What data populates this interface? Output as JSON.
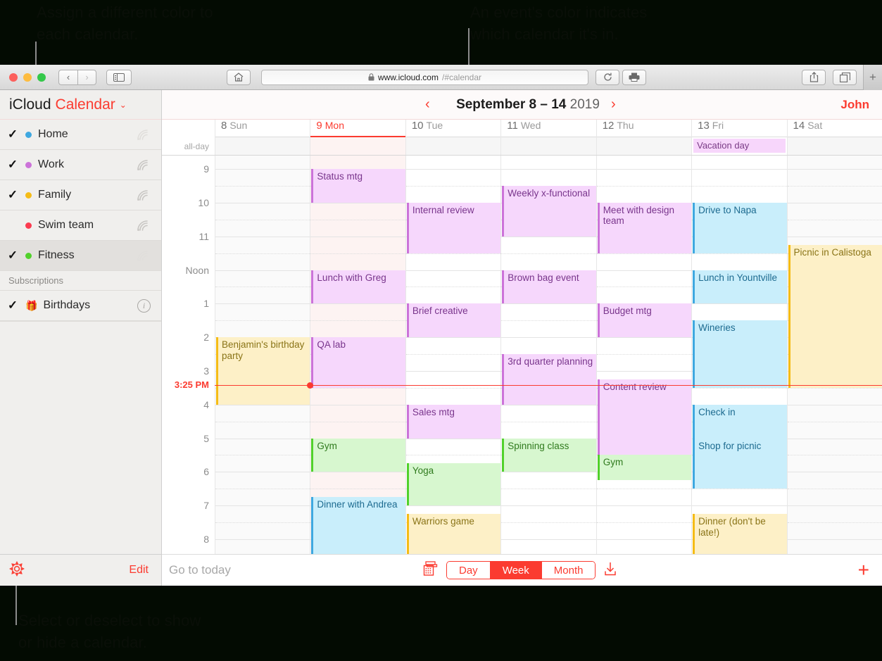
{
  "annotations": {
    "calendar_color": "Assign a different color to\neach calendar.",
    "event_color": "An event's color indicates\nwhich calendar it's in.",
    "select_hide": "Select or deselect to show\nor hide a calendar."
  },
  "browser": {
    "url_host": "www.icloud.com",
    "url_path": "/#calendar",
    "lock_icon": "lock-icon",
    "home_icon": "home-icon",
    "back_icon": "‹",
    "forward_icon": "›",
    "sidebar_icon": "sidebar-icon",
    "reload_icon": "reload-icon",
    "print_icon": "print-icon",
    "share_icon": "share-icon",
    "tabs_icon": "tabs-icon",
    "newtab_icon": "+"
  },
  "sidebar": {
    "brand_first": "iCloud",
    "brand_second": "Calendar",
    "brand_caret": "⌄",
    "calendars": [
      {
        "label": "Home",
        "color": "#3fa8e0",
        "checked": true,
        "check": "✓",
        "selected": false,
        "share": "share-icon-faded"
      },
      {
        "label": "Work",
        "color": "#cc73d9",
        "checked": true,
        "check": "✓",
        "selected": false,
        "share": "share-icon"
      },
      {
        "label": "Family",
        "color": "#f5bc16",
        "checked": true,
        "check": "✓",
        "selected": false,
        "share": "share-icon"
      },
      {
        "label": "Swim team",
        "color": "#fb3b4f",
        "checked": false,
        "check": "",
        "selected": false,
        "share": "share-icon"
      },
      {
        "label": "Fitness",
        "color": "#51d12b",
        "checked": true,
        "check": "✓",
        "selected": true,
        "share": "share-icon-faded"
      }
    ],
    "subscriptions_label": "Subscriptions",
    "subscriptions": [
      {
        "label": "Birthdays",
        "icon": "gift-icon",
        "check": "✓",
        "info": "i"
      }
    ],
    "settings_icon": "gear-icon",
    "edit_label": "Edit"
  },
  "header": {
    "prev_icon": "‹",
    "next_icon": "›",
    "range": "September 8 – 14",
    "year": "2019",
    "account": "John"
  },
  "calendar": {
    "allday_label": "all-day",
    "days": [
      {
        "num": "8",
        "name": "Sun",
        "today": false,
        "weekend": true
      },
      {
        "num": "9",
        "name": "Mon",
        "today": true,
        "weekend": false
      },
      {
        "num": "10",
        "name": "Tue",
        "today": false,
        "weekend": false
      },
      {
        "num": "11",
        "name": "Wed",
        "today": false,
        "weekend": false
      },
      {
        "num": "12",
        "name": "Thu",
        "today": false,
        "weekend": false
      },
      {
        "num": "13",
        "name": "Fri",
        "today": false,
        "weekend": false
      },
      {
        "num": "14",
        "name": "Sat",
        "today": false,
        "weekend": true
      }
    ],
    "time_labels": [
      "9",
      "10",
      "11",
      "Noon",
      "1",
      "2",
      "3",
      "4",
      "5",
      "6",
      "7",
      "8"
    ],
    "now_time": "3:25 PM",
    "allday_events": [
      {
        "day": 5,
        "title": "Vacation day",
        "bg": "#f7d6fb",
        "fg": "#7a3b86"
      }
    ],
    "events": [
      {
        "day": 0,
        "title": "Benjamin's birthday party",
        "start": 14.0,
        "end": 16.0,
        "bg": "#fdf0c7",
        "fg": "#8a7417",
        "bar": "#f5bc16"
      },
      {
        "day": 1,
        "title": "Status mtg",
        "start": 9.0,
        "end": 10.0,
        "bg": "#f6d7fc",
        "fg": "#79358c",
        "bar": "#cc73d9"
      },
      {
        "day": 1,
        "title": "Lunch with Greg",
        "start": 12.0,
        "end": 13.0,
        "bg": "#f6d7fc",
        "fg": "#79358c",
        "bar": "#cc73d9"
      },
      {
        "day": 1,
        "title": "QA lab",
        "start": 14.0,
        "end": 15.5,
        "bg": "#f6d7fc",
        "fg": "#79358c",
        "bar": "#cc73d9"
      },
      {
        "day": 1,
        "title": "Gym",
        "start": 17.0,
        "end": 18.0,
        "bg": "#d7f7cf",
        "fg": "#2f7a1d",
        "bar": "#51d12b"
      },
      {
        "day": 1,
        "title": "Dinner with Andrea",
        "start": 18.75,
        "end": 20.5,
        "bg": "#c9eefb",
        "fg": "#1d6b90",
        "bar": "#3fa8e0"
      },
      {
        "day": 2,
        "title": "Internal review",
        "start": 10.0,
        "end": 11.5,
        "bg": "#f6d7fc",
        "fg": "#79358c",
        "bar": "#cc73d9"
      },
      {
        "day": 2,
        "title": "Brief creative",
        "start": 13.0,
        "end": 14.0,
        "bg": "#f6d7fc",
        "fg": "#79358c",
        "bar": "#cc73d9"
      },
      {
        "day": 2,
        "title": "Sales mtg",
        "start": 16.0,
        "end": 17.0,
        "bg": "#f6d7fc",
        "fg": "#79358c",
        "bar": "#cc73d9"
      },
      {
        "day": 2,
        "title": "Yoga",
        "start": 17.75,
        "end": 19.0,
        "bg": "#d7f7cf",
        "fg": "#2f7a1d",
        "bar": "#51d12b"
      },
      {
        "day": 2,
        "title": "Warriors game",
        "start": 19.25,
        "end": 21.0,
        "bg": "#fdf0c7",
        "fg": "#8a7417",
        "bar": "#f5bc16"
      },
      {
        "day": 3,
        "title": "Weekly x-functional",
        "start": 9.5,
        "end": 11.0,
        "bg": "#f6d7fc",
        "fg": "#79358c",
        "bar": "#cc73d9"
      },
      {
        "day": 3,
        "title": "Brown bag event",
        "start": 12.0,
        "end": 13.0,
        "bg": "#f6d7fc",
        "fg": "#79358c",
        "bar": "#cc73d9"
      },
      {
        "day": 3,
        "title": "3rd quarter planning",
        "start": 14.5,
        "end": 16.0,
        "bg": "#f6d7fc",
        "fg": "#79358c",
        "bar": "#cc73d9"
      },
      {
        "day": 3,
        "title": "Spinning class",
        "start": 17.0,
        "end": 18.0,
        "bg": "#d7f7cf",
        "fg": "#2f7a1d",
        "bar": "#51d12b"
      },
      {
        "day": 4,
        "title": "Meet with design team",
        "start": 10.0,
        "end": 11.5,
        "bg": "#f6d7fc",
        "fg": "#79358c",
        "bar": "#cc73d9"
      },
      {
        "day": 4,
        "title": "Budget mtg",
        "start": 13.0,
        "end": 14.0,
        "bg": "#f6d7fc",
        "fg": "#79358c",
        "bar": "#cc73d9"
      },
      {
        "day": 4,
        "title": "Content review",
        "start": 15.25,
        "end": 17.5,
        "bg": "#f6d7fc",
        "fg": "#79358c",
        "bar": "#cc73d9"
      },
      {
        "day": 4,
        "title": "Gym",
        "start": 17.5,
        "end": 18.25,
        "bg": "#d7f7cf",
        "fg": "#2f7a1d",
        "bar": "#51d12b"
      },
      {
        "day": 5,
        "title": "Drive to Napa",
        "start": 10.0,
        "end": 11.5,
        "bg": "#c9eefb",
        "fg": "#1d6b90",
        "bar": "#3fa8e0"
      },
      {
        "day": 5,
        "title": "Lunch in Yountville",
        "start": 12.0,
        "end": 13.0,
        "bg": "#c9eefb",
        "fg": "#1d6b90",
        "bar": "#3fa8e0"
      },
      {
        "day": 5,
        "title": "Wineries",
        "start": 13.5,
        "end": 15.5,
        "bg": "#c9eefb",
        "fg": "#1d6b90",
        "bar": "#3fa8e0"
      },
      {
        "day": 5,
        "title": "Check in",
        "start": 16.0,
        "end": 17.0,
        "bg": "#c9eefb",
        "fg": "#1d6b90",
        "bar": "#3fa8e0"
      },
      {
        "day": 5,
        "title": "Shop for picnic",
        "start": 17.0,
        "end": 18.5,
        "bg": "#c9eefb",
        "fg": "#1d6b90",
        "bar": "#3fa8e0"
      },
      {
        "day": 5,
        "title": "Dinner (don't be late!)",
        "start": 19.25,
        "end": 21.0,
        "bg": "#fdf0c7",
        "fg": "#8a7417",
        "bar": "#f5bc16"
      },
      {
        "day": 6,
        "title": "Picnic in Calistoga",
        "start": 11.25,
        "end": 15.5,
        "bg": "#fdf0c7",
        "fg": "#8a7417",
        "bar": "#f5bc16"
      }
    ]
  },
  "bottom_bar": {
    "goto_today": "Go to today",
    "minical_icon": "mini-calendar-icon",
    "views": [
      {
        "label": "Day",
        "active": false
      },
      {
        "label": "Week",
        "active": true
      },
      {
        "label": "Month",
        "active": false
      }
    ],
    "download_icon": "download-icon",
    "add_icon": "+"
  }
}
